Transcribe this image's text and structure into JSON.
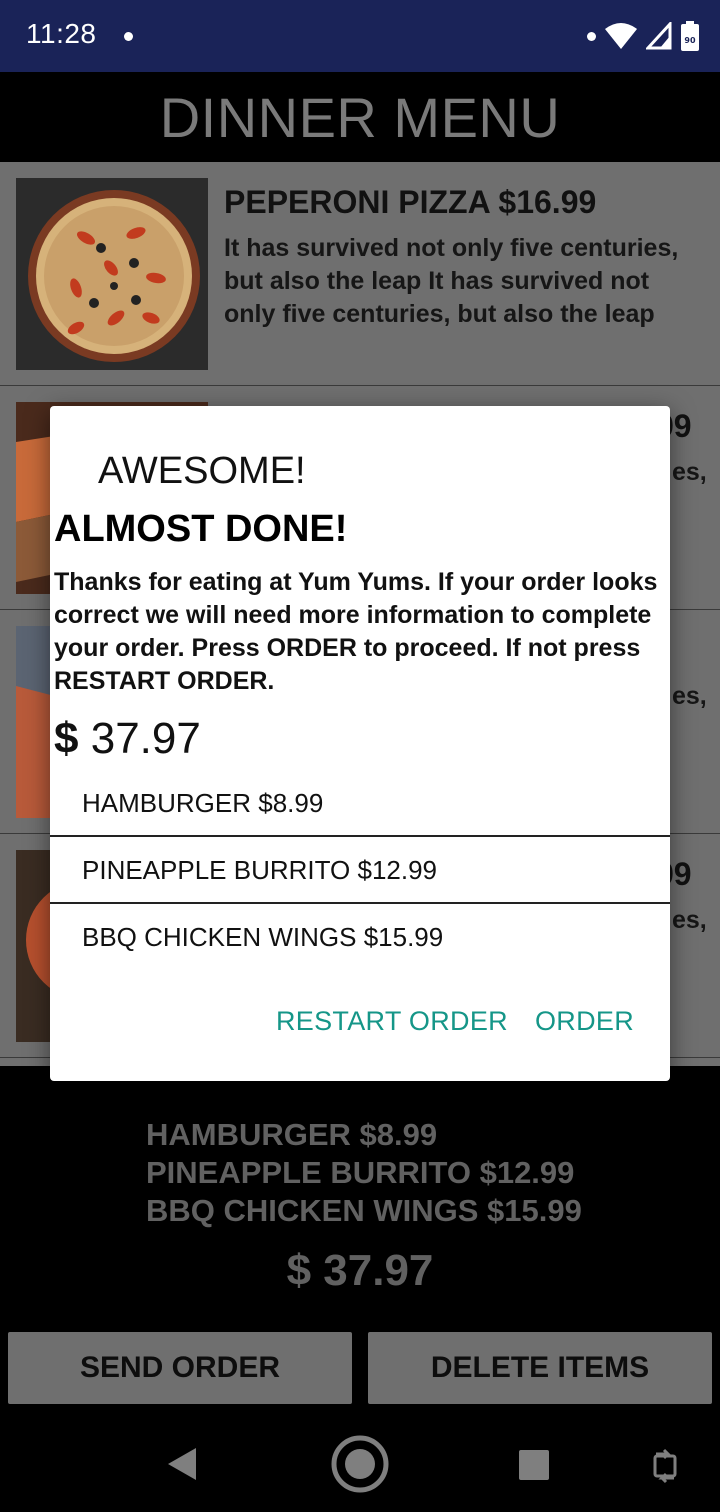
{
  "status_bar": {
    "time": "11:28",
    "battery_level": "90"
  },
  "app": {
    "title": "DINNER MENU"
  },
  "menu": {
    "items": [
      {
        "title": "PEPERONI PIZZA $16.99",
        "description": "It has survived not only five centuries, but also the leap It has survived not only five centuries, but also the leap"
      },
      {
        "title": "99",
        "description": "es,"
      },
      {
        "title": "",
        "description": "es,"
      },
      {
        "title": "99",
        "description": "es,"
      }
    ]
  },
  "order_panel": {
    "items": [
      "HAMBURGER $8.99",
      "PINEAPPLE BURRITO $12.99",
      "BBQ CHICKEN WINGS $15.99"
    ],
    "total": "$ 37.97",
    "send_label": "SEND ORDER",
    "delete_label": "DELETE ITEMS"
  },
  "dialog": {
    "title": "AWESOME!",
    "heading": "ALMOST DONE!",
    "message": "Thanks for eating at Yum Yums. If your order looks correct we will need more information to complete your order. Press ORDER to proceed. If not press RESTART ORDER.",
    "currency_symbol": "$",
    "total_amount": "37.97",
    "items": [
      "HAMBURGER $8.99",
      "PINEAPPLE BURRITO $12.99",
      "BBQ CHICKEN WINGS $15.99"
    ],
    "restart_label": "RESTART ORDER",
    "order_label": "ORDER"
  },
  "colors": {
    "status_bar": "#1a2358",
    "dialog_button": "#159688",
    "panel_text": "#616161"
  }
}
